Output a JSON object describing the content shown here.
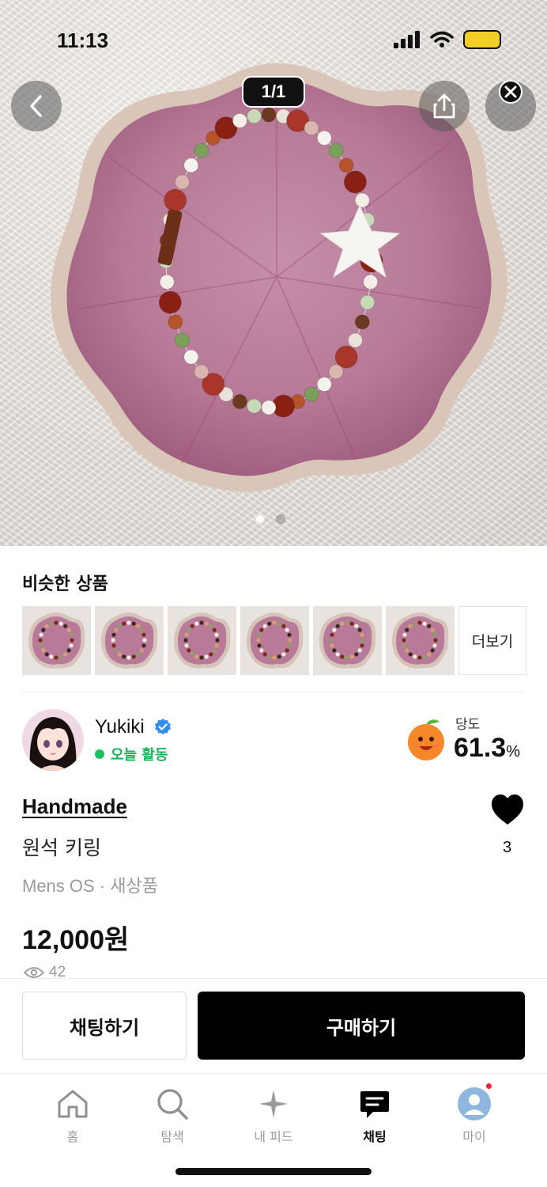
{
  "status_bar": {
    "time": "11:13"
  },
  "hero": {
    "counter": "1/1",
    "buttons": {
      "back": "chevron-left-icon",
      "share": "share-icon",
      "close": "close-icon"
    }
  },
  "similar": {
    "title": "비슷한 상품",
    "more_label": "더보기",
    "item_count": 6
  },
  "seller": {
    "name": "Yukiki",
    "status": "오늘 활동",
    "sweetness_label": "당도",
    "sweetness_value": "61.3",
    "sweetness_unit": "%"
  },
  "product": {
    "title": "Handmade",
    "subtitle": "원석 키링",
    "meta": "Mens OS · 새상품",
    "price": "12,000원",
    "views": "42",
    "likes": "3"
  },
  "actions": {
    "chat": "채팅하기",
    "buy": "구매하기"
  },
  "tabs": [
    {
      "label": "홈",
      "icon": "home-icon"
    },
    {
      "label": "탐색",
      "icon": "search-icon"
    },
    {
      "label": "내 피드",
      "icon": "sparkle-icon"
    },
    {
      "label": "채팅",
      "icon": "chat-icon",
      "active": true
    },
    {
      "label": "마이",
      "icon": "profile-icon"
    }
  ],
  "colors": {
    "accent": "#000000",
    "active_green": "#19c162",
    "notify_red": "#ee2233",
    "dish_pink": "#b97a9a"
  }
}
